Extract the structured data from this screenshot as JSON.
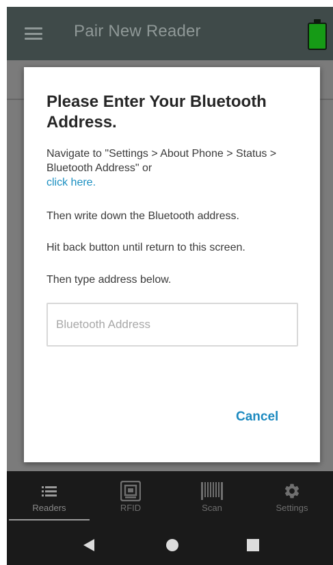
{
  "appbar": {
    "title": "Pair New Reader",
    "menu_icon": "hamburger-menu-icon",
    "battery_icon": "battery-full-icon",
    "battery_color": "#169b16"
  },
  "dialog": {
    "title": "Please Enter Your Bluetooth Address.",
    "instruction": "Navigate to \"Settings > About Phone > Status > Bluetooth Address\" or",
    "link_text": "click here.",
    "step2": "Then write down the Bluetooth address.",
    "step3": "Hit back button until return to this screen.",
    "step4": "Then type address below.",
    "input_placeholder": "Bluetooth Address",
    "input_value": "",
    "cancel_label": "Cancel",
    "accent_color": "#1d8ac0"
  },
  "bottom_nav": {
    "items": [
      {
        "label": "Readers",
        "icon": "list-icon",
        "active": true
      },
      {
        "label": "RFID",
        "icon": "rfid-tag-icon",
        "active": false
      },
      {
        "label": "Scan",
        "icon": "barcode-icon",
        "active": false
      },
      {
        "label": "Settings",
        "icon": "gear-icon",
        "active": false
      }
    ]
  },
  "system_nav": {
    "back_icon": "back-triangle-icon",
    "home_icon": "home-circle-icon",
    "recents_icon": "recents-square-icon"
  }
}
